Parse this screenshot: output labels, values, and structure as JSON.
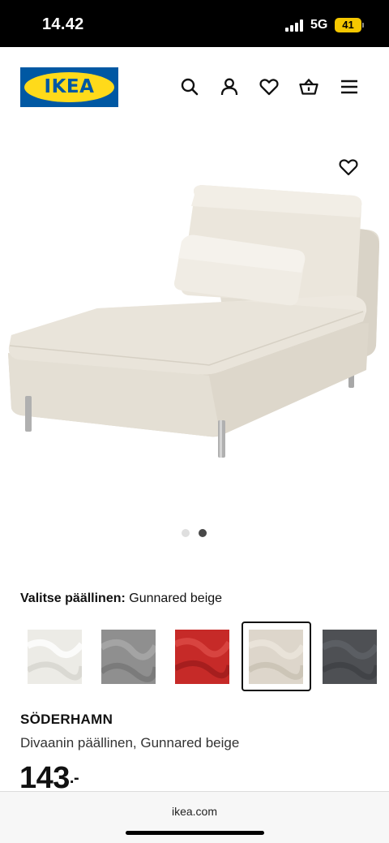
{
  "status_bar": {
    "time": "14.42",
    "network": "5G",
    "battery": "41"
  },
  "header": {
    "logo_text": "IKEA",
    "icons": [
      "search-icon",
      "account-icon",
      "favourites-icon",
      "shopping-bag-icon",
      "menu-icon"
    ]
  },
  "product": {
    "image_count": 2,
    "active_image": 2,
    "cover_label": "Valitse päällinen:",
    "cover_value": "Gunnared beige",
    "swatches": [
      {
        "name": "white",
        "color": "#ecebe6",
        "selected": false
      },
      {
        "name": "grey",
        "color": "#8f8f8f",
        "selected": false
      },
      {
        "name": "red",
        "color": "#c62a28",
        "selected": false
      },
      {
        "name": "Gunnared beige",
        "color": "#ddd6cb",
        "selected": true
      },
      {
        "name": "dark grey",
        "color": "#4e5054",
        "selected": false
      }
    ],
    "brand": "SÖDERHAMN",
    "description": "Divaanin päällinen, Gunnared beige",
    "price": "143",
    "price_suffix": ".-"
  },
  "colors": {
    "ikea_blue": "#0058a3",
    "ikea_yellow": "#ffda1a",
    "fabric": "#e6e1d6"
  },
  "browser": {
    "url": "ikea.com"
  }
}
